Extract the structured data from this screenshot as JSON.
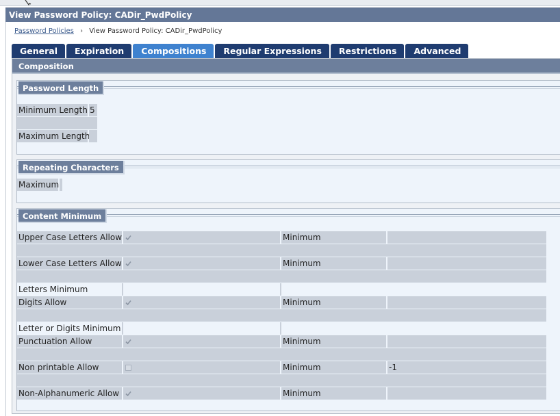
{
  "window": {
    "title": "View Password Policy: CADir_PwdPolicy"
  },
  "breadcrumb": {
    "parent": "Password Policies",
    "separator": "›",
    "current": "View Password Policy: CADir_PwdPolicy"
  },
  "tabs": [
    {
      "label": "General",
      "active": false
    },
    {
      "label": "Expiration",
      "active": false
    },
    {
      "label": "Compositions",
      "active": true
    },
    {
      "label": "Regular Expressions",
      "active": false
    },
    {
      "label": "Restrictions",
      "active": false
    },
    {
      "label": "Advanced",
      "active": false
    }
  ],
  "panel": {
    "title": "Composition"
  },
  "password_length": {
    "title": "Password Length",
    "min_label": "Minimum Length",
    "min_value": "5",
    "max_label": "Maximum Length",
    "max_value": ""
  },
  "repeating": {
    "title": "Repeating Characters",
    "max_label": "Maximum",
    "max_value": ""
  },
  "content_minimum": {
    "title": "Content Minimum",
    "minimum_label": "Minimum",
    "rows": {
      "upper": {
        "label": "Upper Case Letters Allow",
        "checked": true,
        "minimum": ""
      },
      "lower": {
        "label": "Lower Case Letters Allow",
        "checked": true,
        "minimum": ""
      },
      "letters_min": {
        "label": "Letters Minimum",
        "value": ""
      },
      "digits": {
        "label": "Digits Allow",
        "checked": true,
        "minimum": ""
      },
      "letter_digits_min": {
        "label": "Letter or Digits Minimum",
        "value": ""
      },
      "punct": {
        "label": "Punctuation Allow",
        "checked": true,
        "minimum": ""
      },
      "nonprint": {
        "label": "Non printable Allow",
        "checked": false,
        "minimum": "-1"
      },
      "nonalnum": {
        "label": "Non-Alphanumeric Allow",
        "checked": true,
        "minimum": ""
      }
    }
  },
  "colors": {
    "titlebar": "#647797",
    "tab": "#1f3c70",
    "tab_active": "#3f82cf",
    "section_head": "#6d7f9c",
    "cell": "#c9d0da"
  }
}
